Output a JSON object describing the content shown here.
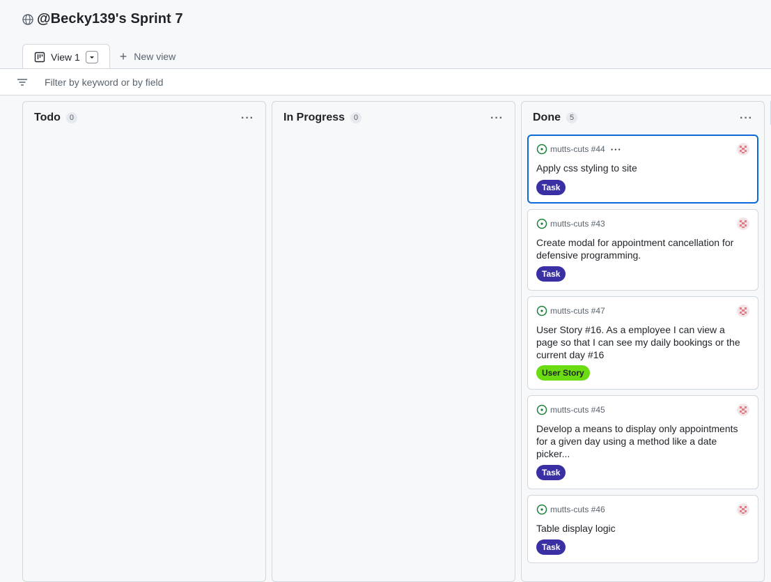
{
  "project": {
    "title": "@Becky139's Sprint 7",
    "icon": "globe-icon"
  },
  "tabs": {
    "active_label": "View 1",
    "new_view_label": "New view"
  },
  "filter": {
    "placeholder": "Filter by keyword or by field"
  },
  "columns": [
    {
      "name": "Todo",
      "count": "0"
    },
    {
      "name": "In Progress",
      "count": "0"
    },
    {
      "name": "Done",
      "count": "5"
    }
  ],
  "cards": [
    {
      "ref": "mutts-cuts #44",
      "title": "Apply css styling to site",
      "label": "Task"
    },
    {
      "ref": "mutts-cuts #43",
      "title": "Create modal for appointment cancellation for defensive programming.",
      "label": "Task"
    },
    {
      "ref": "mutts-cuts #47",
      "title": "User Story #16. As a employee I can view a page so that I can see my daily bookings or the current day #16",
      "label": "User Story"
    },
    {
      "ref": "mutts-cuts #45",
      "title": "Develop a means to display only appointments for a given day using a method like a date picker...",
      "label": "Task"
    },
    {
      "ref": "mutts-cuts #46",
      "title": "Table display logic",
      "label": "Task"
    }
  ],
  "colors": {
    "task_label": "#3a2fa3",
    "story_label": "#6bdb12",
    "selected_border": "#0969da",
    "open_issue": "#1a7f37"
  }
}
